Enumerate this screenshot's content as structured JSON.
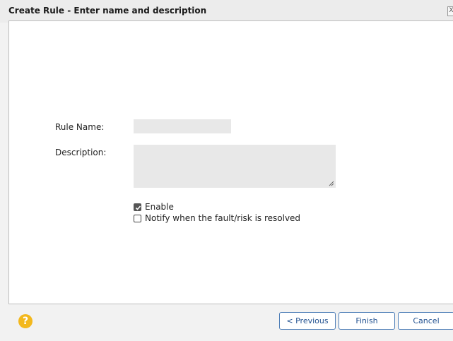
{
  "dialog": {
    "title": "Create Rule - Enter name and description",
    "close_glyph": "X"
  },
  "form": {
    "rule_name_label": "Rule Name:",
    "rule_name_value": "",
    "description_label": "Description:",
    "description_value": "",
    "enable_label": "Enable",
    "enable_checked": true,
    "notify_label": "Notify when the fault/risk is resolved",
    "notify_checked": false
  },
  "footer": {
    "help_glyph": "?",
    "previous_label": "< Previous",
    "finish_label": "Finish",
    "cancel_label": "Cancel"
  },
  "colors": {
    "help_icon": "#f3b81d",
    "button_border": "#4f7fb8",
    "input_bg": "#e8e8e8"
  }
}
